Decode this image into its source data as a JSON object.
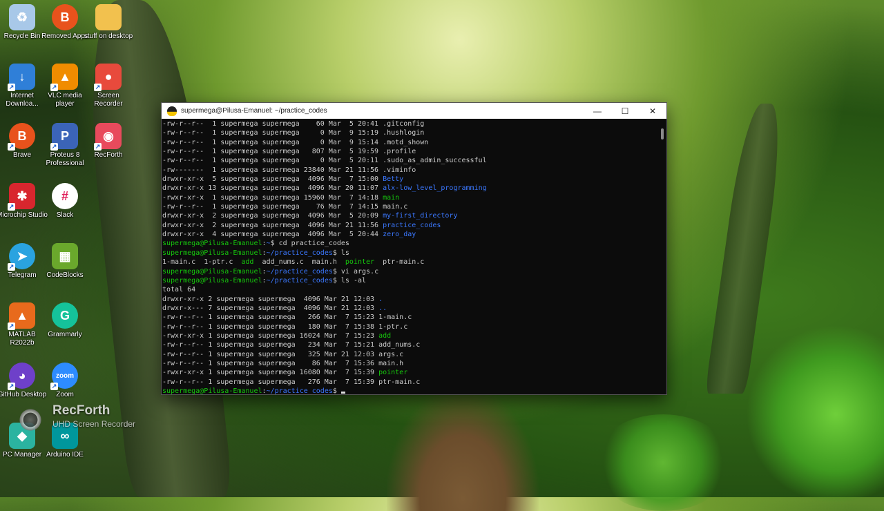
{
  "desktop": {
    "icons": [
      {
        "label": "Recycle Bin",
        "icon": "recycle-bin-icon",
        "color": "#a8c8e8",
        "glyph": "♻",
        "shortcut": false
      },
      {
        "label": "Removed Apps",
        "icon": "brave-lion-icon",
        "color": "#e8521c",
        "glyph": "B",
        "shortcut": false
      },
      {
        "label": "stuff on desktop",
        "icon": "folder-icon",
        "color": "#f2c14e",
        "glyph": "",
        "shortcut": false
      },
      {
        "label": "Internet Downloa...",
        "icon": "internet-download-icon",
        "color": "#2f7fd8",
        "glyph": "↓",
        "shortcut": true
      },
      {
        "label": "VLC media player",
        "icon": "vlc-cone-icon",
        "color": "#f08c00",
        "glyph": "▲",
        "shortcut": true
      },
      {
        "label": "Screen Recorder",
        "icon": "screen-recorder-icon",
        "color": "#e84a3c",
        "glyph": "●",
        "shortcut": true
      },
      {
        "label": "Brave",
        "icon": "brave-lion-icon",
        "color": "#e8521c",
        "glyph": "B",
        "shortcut": true
      },
      {
        "label": "Proteus 8 Professional",
        "icon": "proteus-icon",
        "color": "#3b64b8",
        "glyph": "P",
        "shortcut": true
      },
      {
        "label": "RecForth",
        "icon": "recforth-icon",
        "color": "#e84a5c",
        "glyph": "◉",
        "shortcut": true
      },
      {
        "label": "Microchip Studio",
        "icon": "microchip-icon",
        "color": "#d8262e",
        "glyph": "✱",
        "shortcut": true
      },
      {
        "label": "Slack",
        "icon": "slack-icon",
        "color": "#ffffff",
        "glyph": "#",
        "shortcut": false
      },
      {
        "label": "Telegram",
        "icon": "telegram-icon",
        "color": "#2aa3e0",
        "glyph": "➤",
        "shortcut": true
      },
      {
        "label": "CodeBlocks",
        "icon": "codeblocks-icon",
        "color": "#6aa82c",
        "glyph": "▦",
        "shortcut": false
      },
      {
        "label": "MATLAB R2022b",
        "icon": "matlab-icon",
        "color": "#e86a1c",
        "glyph": "▲",
        "shortcut": true
      },
      {
        "label": "Grammarly",
        "icon": "grammarly-icon",
        "color": "#15c39a",
        "glyph": "G",
        "shortcut": false
      },
      {
        "label": "GitHub Desktop",
        "icon": "github-icon",
        "color": "#6e40c9",
        "glyph": "◕",
        "shortcut": true
      },
      {
        "label": "Zoom",
        "icon": "zoom-icon",
        "color": "#2d8cff",
        "glyph": "zoom",
        "shortcut": true
      },
      {
        "label": "PC Manager",
        "icon": "pc-manager-icon",
        "color": "#2bb3a0",
        "glyph": "◆",
        "shortcut": false
      },
      {
        "label": "Arduino IDE",
        "icon": "arduino-icon",
        "color": "#00979c",
        "glyph": "∞",
        "shortcut": false
      }
    ]
  },
  "watermark": {
    "title": "RecForth",
    "subtitle": "UHD Screen Recorder"
  },
  "window": {
    "title": "supermega@Pilusa-Emanuel: ~/practice_codes",
    "minimize": "—",
    "maximize": "☐",
    "close": "✕"
  },
  "terminal": {
    "lines": [
      [
        {
          "t": "-rw-r--r--  1 supermega supermega    60 Mar  5 20:41 .gitconfig",
          "c": "white"
        }
      ],
      [
        {
          "t": "-rw-r--r--  1 supermega supermega     0 Mar  9 15:19 .hushlogin",
          "c": "white"
        }
      ],
      [
        {
          "t": "-rw-r--r--  1 supermega supermega     0 Mar  9 15:14 .motd_shown",
          "c": "white"
        }
      ],
      [
        {
          "t": "-rw-r--r--  1 supermega supermega   807 Mar  5 19:59 .profile",
          "c": "white"
        }
      ],
      [
        {
          "t": "-rw-r--r--  1 supermega supermega     0 Mar  5 20:11 .sudo_as_admin_successful",
          "c": "white"
        }
      ],
      [
        {
          "t": "-rw-------  1 supermega supermega 23840 Mar 21 11:56 .viminfo",
          "c": "white"
        }
      ],
      [
        {
          "t": "drwxr-xr-x  5 supermega supermega  4096 Mar  7 15:00 ",
          "c": "white"
        },
        {
          "t": "Betty",
          "c": "blue"
        }
      ],
      [
        {
          "t": "drwxr-xr-x 13 supermega supermega  4096 Mar 20 11:07 ",
          "c": "white"
        },
        {
          "t": "alx-low_level_programming",
          "c": "blue"
        }
      ],
      [
        {
          "t": "-rwxr-xr-x  1 supermega supermega 15960 Mar  7 14:18 ",
          "c": "white"
        },
        {
          "t": "main",
          "c": "green"
        }
      ],
      [
        {
          "t": "-rw-r--r--  1 supermega supermega    76 Mar  7 14:15 main.c",
          "c": "white"
        }
      ],
      [
        {
          "t": "drwxr-xr-x  2 supermega supermega  4096 Mar  5 20:09 ",
          "c": "white"
        },
        {
          "t": "my-first_directory",
          "c": "blue"
        }
      ],
      [
        {
          "t": "drwxr-xr-x  2 supermega supermega  4096 Mar 21 11:56 ",
          "c": "white"
        },
        {
          "t": "practice_codes",
          "c": "blue"
        }
      ],
      [
        {
          "t": "drwxr-xr-x  4 supermega supermega  4096 Mar  5 20:44 ",
          "c": "white"
        },
        {
          "t": "zero_day",
          "c": "blue"
        }
      ],
      [
        {
          "t": "supermega@Pilusa-Emanuel",
          "c": "prompt"
        },
        {
          "t": ":",
          "c": "white"
        },
        {
          "t": "~",
          "c": "path"
        },
        {
          "t": "$ cd practice_codes",
          "c": "white"
        }
      ],
      [
        {
          "t": "supermega@Pilusa-Emanuel",
          "c": "prompt"
        },
        {
          "t": ":",
          "c": "white"
        },
        {
          "t": "~/practice_codes",
          "c": "path"
        },
        {
          "t": "$ ls",
          "c": "white"
        }
      ],
      [
        {
          "t": "1-main.c  1-ptr.c  ",
          "c": "white"
        },
        {
          "t": "add",
          "c": "green"
        },
        {
          "t": "  add_nums.c  main.h  ",
          "c": "white"
        },
        {
          "t": "pointer",
          "c": "green"
        },
        {
          "t": "  ptr-main.c",
          "c": "white"
        }
      ],
      [
        {
          "t": "supermega@Pilusa-Emanuel",
          "c": "prompt"
        },
        {
          "t": ":",
          "c": "white"
        },
        {
          "t": "~/practice_codes",
          "c": "path"
        },
        {
          "t": "$ vi args.c",
          "c": "white"
        }
      ],
      [
        {
          "t": "supermega@Pilusa-Emanuel",
          "c": "prompt"
        },
        {
          "t": ":",
          "c": "white"
        },
        {
          "t": "~/practice_codes",
          "c": "path"
        },
        {
          "t": "$ ls -al",
          "c": "white"
        }
      ],
      [
        {
          "t": "total 64",
          "c": "white"
        }
      ],
      [
        {
          "t": "drwxr-xr-x 2 supermega supermega  4096 Mar 21 12:03 ",
          "c": "white"
        },
        {
          "t": ".",
          "c": "blue"
        }
      ],
      [
        {
          "t": "drwxr-x--- 7 supermega supermega  4096 Mar 21 12:03 ",
          "c": "white"
        },
        {
          "t": "..",
          "c": "blue"
        }
      ],
      [
        {
          "t": "-rw-r--r-- 1 supermega supermega   266 Mar  7 15:23 1-main.c",
          "c": "white"
        }
      ],
      [
        {
          "t": "-rw-r--r-- 1 supermega supermega   180 Mar  7 15:38 1-ptr.c",
          "c": "white"
        }
      ],
      [
        {
          "t": "-rwxr-xr-x 1 supermega supermega 16024 Mar  7 15:23 ",
          "c": "white"
        },
        {
          "t": "add",
          "c": "green"
        }
      ],
      [
        {
          "t": "-rw-r--r-- 1 supermega supermega   234 Mar  7 15:21 add_nums.c",
          "c": "white"
        }
      ],
      [
        {
          "t": "-rw-r--r-- 1 supermega supermega   325 Mar 21 12:03 args.c",
          "c": "white"
        }
      ],
      [
        {
          "t": "-rw-r--r-- 1 supermega supermega    86 Mar  7 15:36 main.h",
          "c": "white"
        }
      ],
      [
        {
          "t": "-rwxr-xr-x 1 supermega supermega 16080 Mar  7 15:39 ",
          "c": "white"
        },
        {
          "t": "pointer",
          "c": "green"
        }
      ],
      [
        {
          "t": "-rw-r--r-- 1 supermega supermega   276 Mar  7 15:39 ptr-main.c",
          "c": "white"
        }
      ],
      [
        {
          "t": "supermega@Pilusa-Emanuel",
          "c": "prompt"
        },
        {
          "t": ":",
          "c": "white"
        },
        {
          "t": "~/practice_codes",
          "c": "path"
        },
        {
          "t": "$ ",
          "c": "white"
        }
      ]
    ]
  }
}
